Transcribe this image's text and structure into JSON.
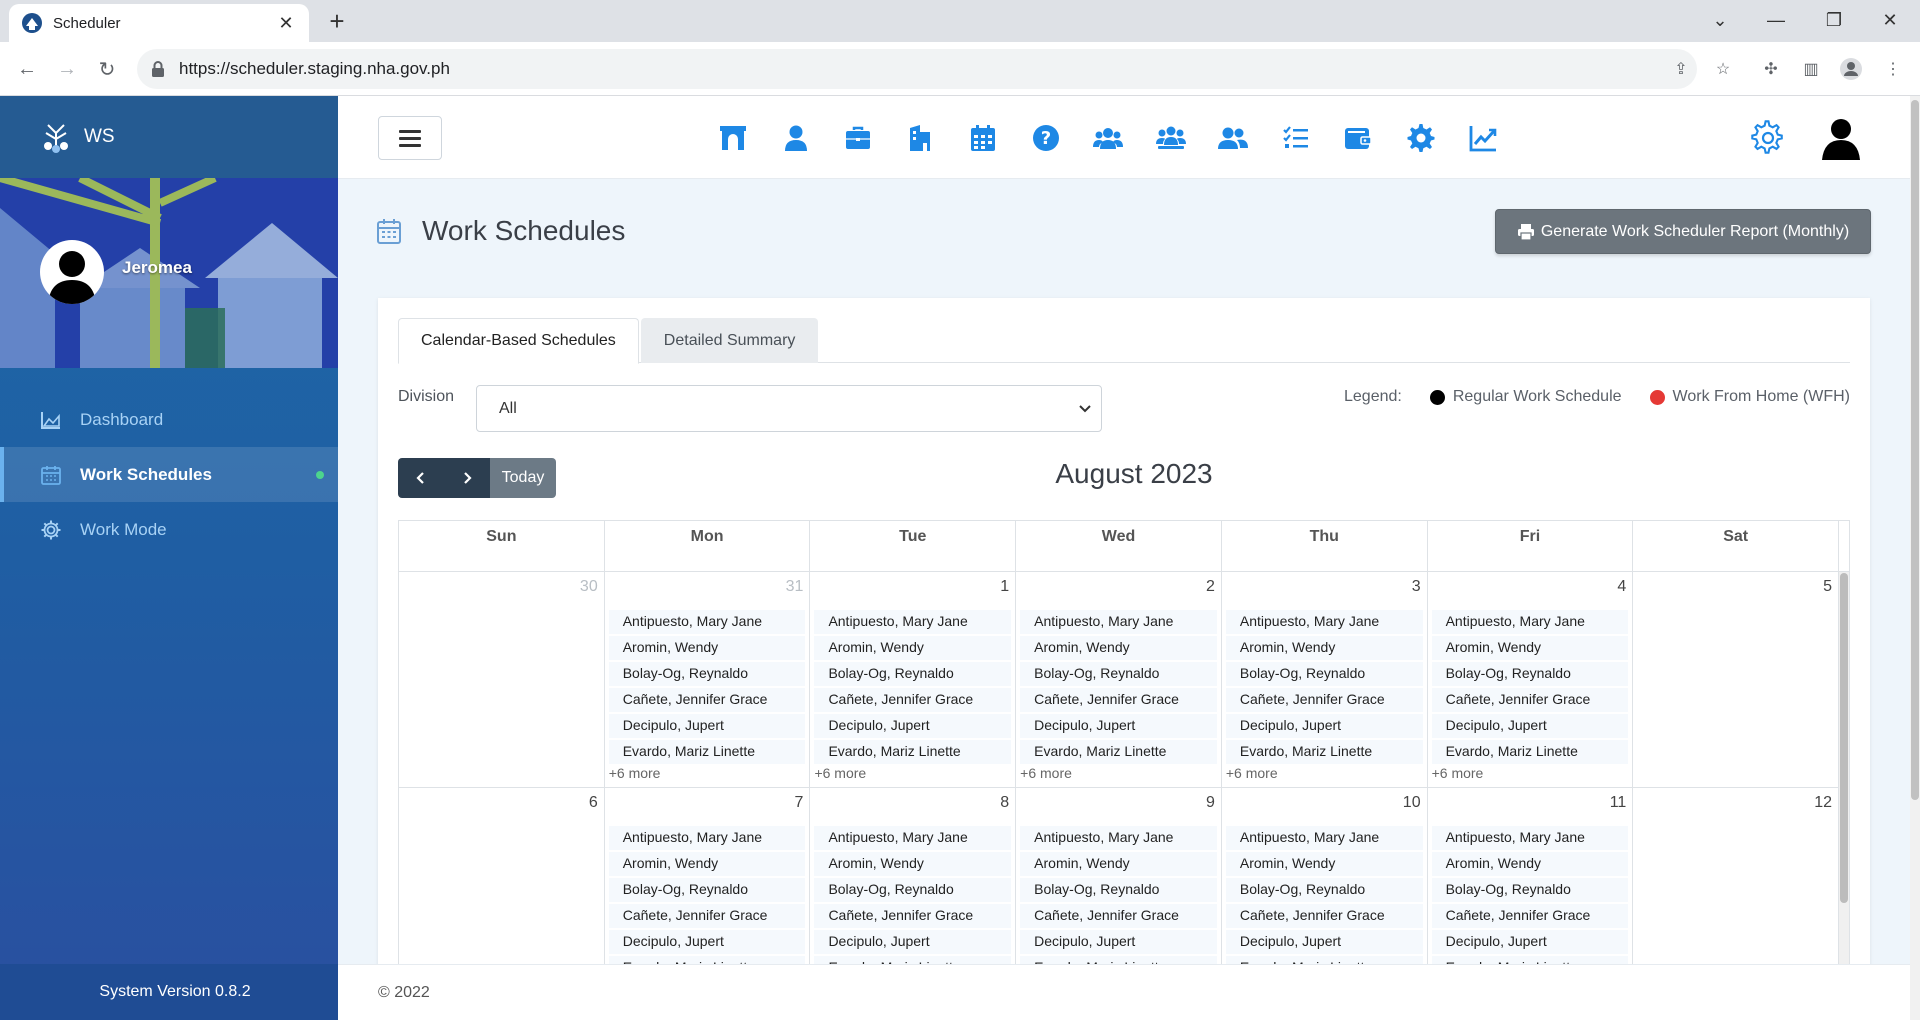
{
  "browser": {
    "tab_title": "Scheduler",
    "url": "https://scheduler.staging.nha.gov.ph"
  },
  "sidebar": {
    "brand": "WS",
    "user_name": "Jeromea",
    "items": [
      {
        "label": "Dashboard",
        "icon": "chart-area-icon"
      },
      {
        "label": "Work Schedules",
        "icon": "calendar-icon"
      },
      {
        "label": "Work Mode",
        "icon": "gear-icon"
      }
    ],
    "version": "System Version 0.8.2"
  },
  "appbar": {
    "icons": [
      "archway-icon",
      "user-icon",
      "briefcase-icon",
      "building-icon",
      "calendar-icon",
      "question-circle-icon",
      "users-icon",
      "users-group-icon",
      "user-friends-icon",
      "tasks-icon",
      "wallet-icon",
      "cog-icon",
      "chart-line-icon"
    ]
  },
  "page": {
    "title": "Work Schedules",
    "report_button": "Generate Work Scheduler Report (Monthly)",
    "tabs": [
      "Calendar-Based Schedules",
      "Detailed Summary"
    ],
    "division_label": "Division",
    "division_value": "All",
    "legend_label": "Legend:",
    "legend": [
      {
        "label": "Regular Work Schedule",
        "color": "#000000"
      },
      {
        "label": "Work From Home (WFH)",
        "color": "#e53935"
      }
    ],
    "today_label": "Today",
    "month_title": "August 2023"
  },
  "calendar": {
    "weekdays": [
      "Sun",
      "Mon",
      "Tue",
      "Wed",
      "Thu",
      "Fri",
      "Sat"
    ],
    "weeks": [
      {
        "days": [
          {
            "num": "30",
            "muted": true,
            "events": [],
            "more": ""
          },
          {
            "num": "31",
            "muted": true,
            "events": [
              "Antipuesto, Mary Jane",
              "Aromin, Wendy",
              "Bolay-Og, Reynaldo",
              "Cañete, Jennifer Grace",
              "Decipulo, Jupert",
              "Evardo, Mariz Linette"
            ],
            "more": "+6 more"
          },
          {
            "num": "1",
            "muted": false,
            "events": [
              "Antipuesto, Mary Jane",
              "Aromin, Wendy",
              "Bolay-Og, Reynaldo",
              "Cañete, Jennifer Grace",
              "Decipulo, Jupert",
              "Evardo, Mariz Linette"
            ],
            "more": "+6 more"
          },
          {
            "num": "2",
            "muted": false,
            "events": [
              "Antipuesto, Mary Jane",
              "Aromin, Wendy",
              "Bolay-Og, Reynaldo",
              "Cañete, Jennifer Grace",
              "Decipulo, Jupert",
              "Evardo, Mariz Linette"
            ],
            "more": "+6 more"
          },
          {
            "num": "3",
            "muted": false,
            "events": [
              "Antipuesto, Mary Jane",
              "Aromin, Wendy",
              "Bolay-Og, Reynaldo",
              "Cañete, Jennifer Grace",
              "Decipulo, Jupert",
              "Evardo, Mariz Linette"
            ],
            "more": "+6 more"
          },
          {
            "num": "4",
            "muted": false,
            "events": [
              "Antipuesto, Mary Jane",
              "Aromin, Wendy",
              "Bolay-Og, Reynaldo",
              "Cañete, Jennifer Grace",
              "Decipulo, Jupert",
              "Evardo, Mariz Linette"
            ],
            "more": "+6 more"
          },
          {
            "num": "5",
            "muted": false,
            "events": [],
            "more": ""
          }
        ]
      },
      {
        "days": [
          {
            "num": "6",
            "muted": false,
            "events": [],
            "more": ""
          },
          {
            "num": "7",
            "muted": false,
            "events": [
              "Antipuesto, Mary Jane",
              "Aromin, Wendy",
              "Bolay-Og, Reynaldo",
              "Cañete, Jennifer Grace",
              "Decipulo, Jupert",
              "Evardo, Mariz Linette"
            ],
            "more": ""
          },
          {
            "num": "8",
            "muted": false,
            "events": [
              "Antipuesto, Mary Jane",
              "Aromin, Wendy",
              "Bolay-Og, Reynaldo",
              "Cañete, Jennifer Grace",
              "Decipulo, Jupert",
              "Evardo, Mariz Linette"
            ],
            "more": ""
          },
          {
            "num": "9",
            "muted": false,
            "events": [
              "Antipuesto, Mary Jane",
              "Aromin, Wendy",
              "Bolay-Og, Reynaldo",
              "Cañete, Jennifer Grace",
              "Decipulo, Jupert",
              "Evardo, Mariz Linette"
            ],
            "more": ""
          },
          {
            "num": "10",
            "muted": false,
            "events": [
              "Antipuesto, Mary Jane",
              "Aromin, Wendy",
              "Bolay-Og, Reynaldo",
              "Cañete, Jennifer Grace",
              "Decipulo, Jupert",
              "Evardo, Mariz Linette"
            ],
            "more": ""
          },
          {
            "num": "11",
            "muted": false,
            "events": [
              "Antipuesto, Mary Jane",
              "Aromin, Wendy",
              "Bolay-Og, Reynaldo",
              "Cañete, Jennifer Grace",
              "Decipulo, Jupert",
              "Evardo, Mariz Linette"
            ],
            "more": ""
          },
          {
            "num": "12",
            "muted": false,
            "events": [],
            "more": ""
          }
        ]
      }
    ]
  },
  "footer": "© 2022",
  "colors": {
    "accent": "#1e88e5",
    "sidebar": "#1f5ea3",
    "button_dark": "#2c3e50"
  }
}
